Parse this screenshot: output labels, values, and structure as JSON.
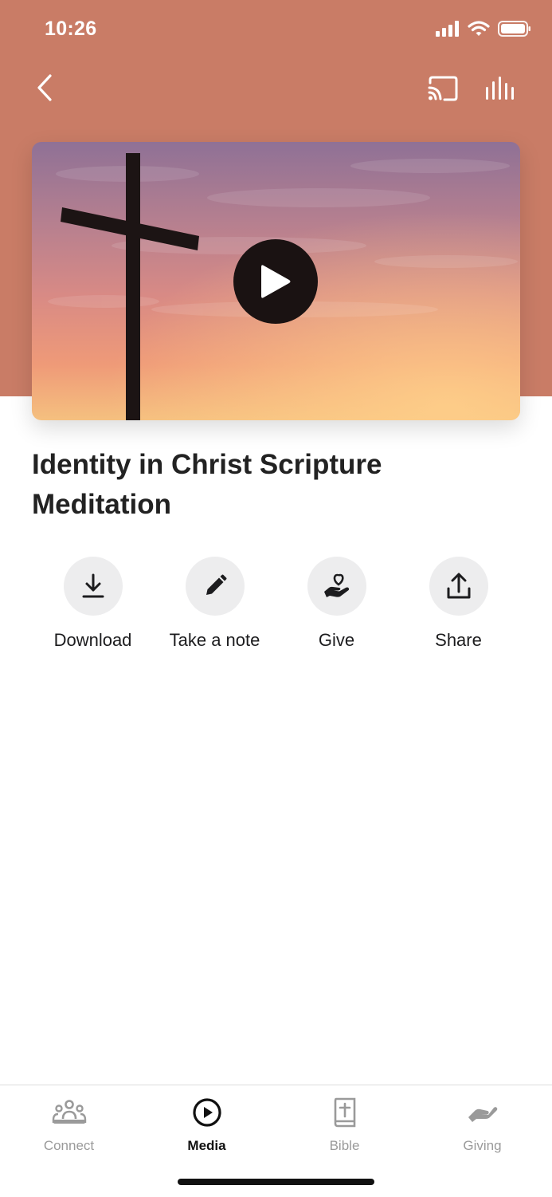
{
  "status_bar": {
    "time": "10:26"
  },
  "episode": {
    "title": "Identity in Christ Scripture Meditation"
  },
  "actions": [
    {
      "label": "Download",
      "icon": "download-icon"
    },
    {
      "label": "Take a note",
      "icon": "pencil-icon"
    },
    {
      "label": "Give",
      "icon": "heart-hand-icon"
    },
    {
      "label": "Share",
      "icon": "share-icon"
    }
  ],
  "tabs": [
    {
      "label": "Connect",
      "icon": "people-icon",
      "active": false
    },
    {
      "label": "Media",
      "icon": "play-circle-icon",
      "active": true
    },
    {
      "label": "Bible",
      "icon": "bible-icon",
      "active": false
    },
    {
      "label": "Giving",
      "icon": "giving-hand-icon",
      "active": false
    }
  ],
  "colors": {
    "header_bg": "#c97c66",
    "action_circle": "#ededee",
    "tab_inactive": "#9a9a9a",
    "tab_active": "#111111"
  }
}
